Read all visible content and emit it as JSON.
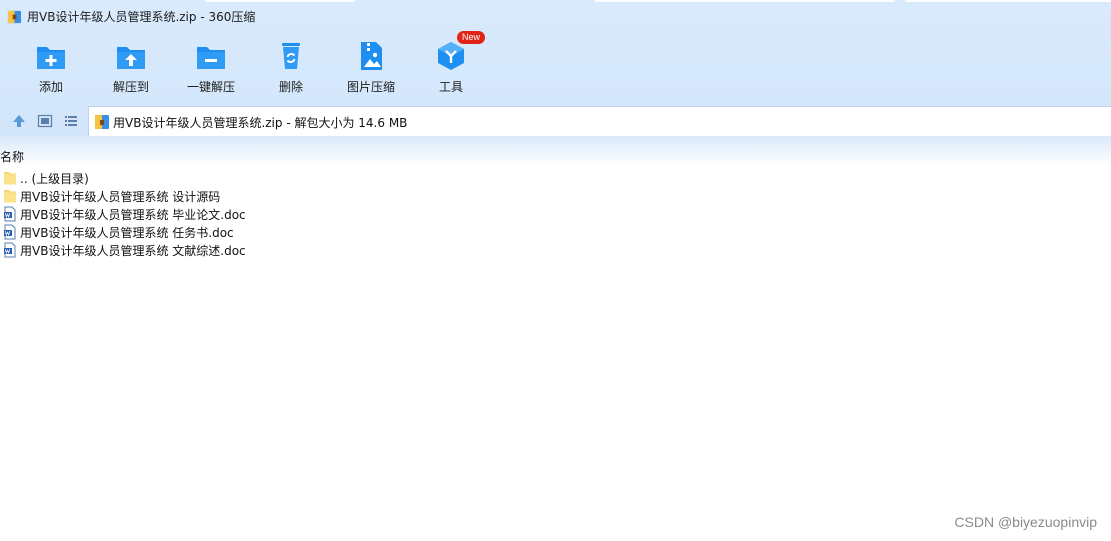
{
  "window": {
    "title": "用VB设计年级人员管理系统.zip - 360压缩"
  },
  "toolbar": {
    "items": [
      {
        "label": "添加",
        "icon": "folder-add-icon"
      },
      {
        "label": "解压到",
        "icon": "folder-extract-icon"
      },
      {
        "label": "一键解压",
        "icon": "folder-minus-icon"
      },
      {
        "label": "删除",
        "icon": "recycle-bin-icon"
      },
      {
        "label": "图片压缩",
        "icon": "image-compress-icon"
      },
      {
        "label": "工具",
        "icon": "tools-cube-icon",
        "badge": "New"
      }
    ]
  },
  "address": {
    "path": "用VB设计年级人员管理系统.zip - 解包大小为 14.6 MB"
  },
  "list": {
    "column_name": "名称",
    "rows": [
      {
        "name": ".. (上级目录)",
        "type": "folder"
      },
      {
        "name": "用VB设计年级人员管理系统 设计源码",
        "type": "folder"
      },
      {
        "name": "用VB设计年级人员管理系统 毕业论文.doc",
        "type": "doc"
      },
      {
        "name": "用VB设计年级人员管理系统 任务书.doc",
        "type": "doc"
      },
      {
        "name": "用VB设计年级人员管理系统 文献综述.doc",
        "type": "doc"
      }
    ]
  },
  "watermark": "CSDN @biyezuopinvip",
  "colors": {
    "accent": "#1e8ff0",
    "toolbar_bg": "#d9eafc",
    "badge": "#e2231a",
    "folder": "#f7d774"
  }
}
